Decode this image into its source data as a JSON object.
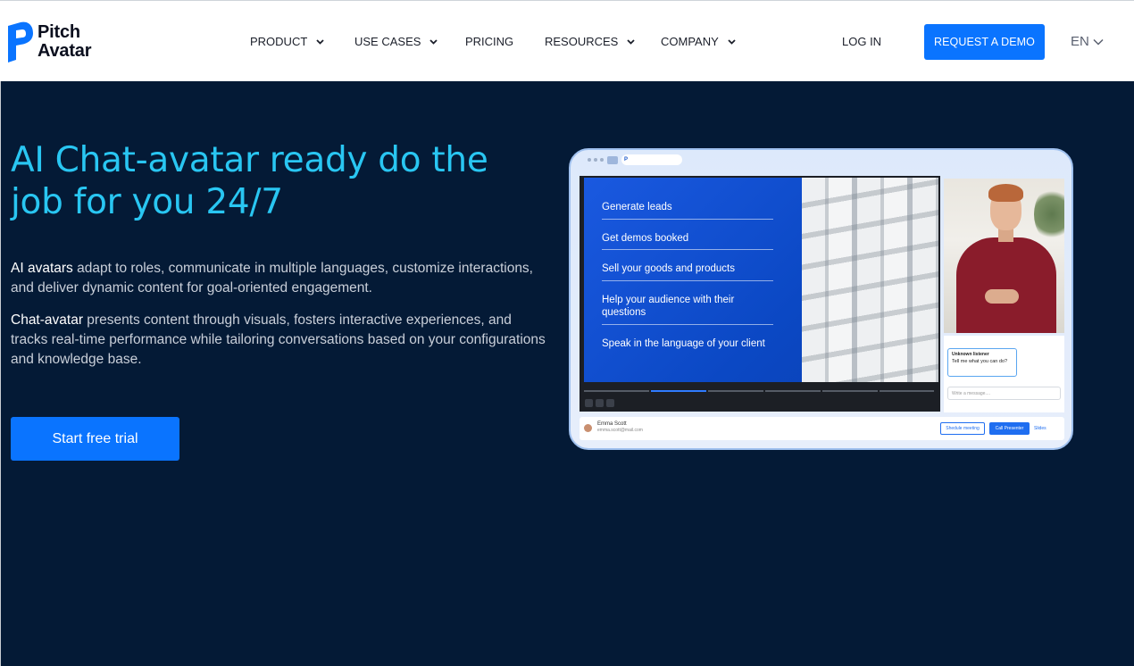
{
  "brand": {
    "line1": "Pitch",
    "line2": "Avatar"
  },
  "nav": {
    "items": [
      {
        "label": "PRODUCT",
        "dropdown": true
      },
      {
        "label": "USE CASES",
        "dropdown": true
      },
      {
        "label": "PRICING",
        "dropdown": false
      },
      {
        "label": "RESOURCES",
        "dropdown": true
      },
      {
        "label": "COMPANY",
        "dropdown": true
      }
    ],
    "login": "LOG IN",
    "cta": "REQUEST A DEMO",
    "language": "EN"
  },
  "hero": {
    "title": "AI Chat-avatar ready do the job for you 24/7",
    "p1_strong": "AI avatars",
    "p1_rest": " adapt to roles, communicate in multiple languages, customize interactions, and deliver dynamic content for goal-oriented engagement.",
    "p2_strong": "Chat-avatar",
    "p2_rest": " presents content through visuals, fosters interactive experiences, and tracks real-time performance while tailoring conversations based on your configurations and knowledge base.",
    "cta": "Start free trial"
  },
  "mockup": {
    "slide_items": [
      "Generate leads",
      "Get demos booked",
      "Sell your goods and products",
      "Help your audience with their questions",
      "Speak in the language of your client"
    ],
    "chat_name": "Unknown listener",
    "chat_text": "Tell me what you can do?",
    "message_placeholder": "Write a message....",
    "presenter_name": "Emma Scott",
    "presenter_email": "emma.scott@mail.com",
    "schedule_btn": "Shedule meeting",
    "call_btn": "Call Presenter",
    "slides_btn": "Slides"
  },
  "colors": {
    "accent": "#0a74ff",
    "hero_bg": "#041a36",
    "title": "#29c6f2"
  }
}
